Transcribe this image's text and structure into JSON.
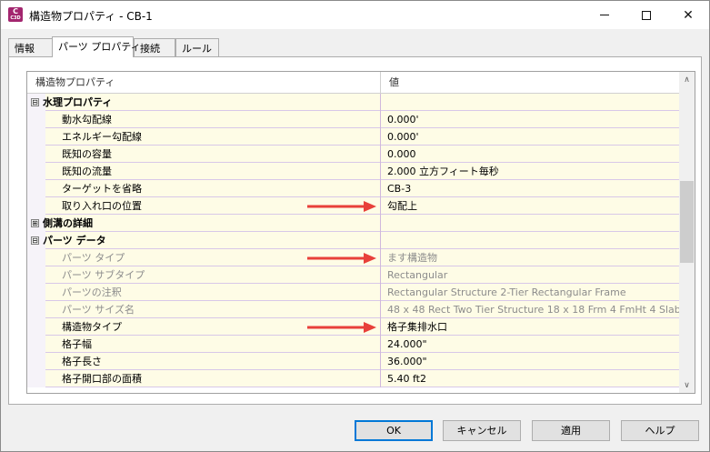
{
  "window": {
    "title": "構造物プロパティ - CB-1",
    "app_icon_letter": "C",
    "app_icon_sub": "C3D",
    "app_icon_name": "civil3d-app-icon",
    "minimize_glyph": "—",
    "maximize_glyph": "☐",
    "close_glyph": "✕"
  },
  "tabs": [
    {
      "label": "情報",
      "active": false
    },
    {
      "label": "パーツ プロパティ",
      "active": true
    },
    {
      "label": "接続",
      "active": false
    },
    {
      "label": "ルール",
      "active": false
    }
  ],
  "grid": {
    "header": {
      "property": "構造物プロパティ",
      "value": "値"
    },
    "rows": [
      {
        "type": "group",
        "expander": "⊟",
        "label": "水理プロパティ",
        "value": ""
      },
      {
        "type": "item",
        "label": "動水勾配線",
        "value": "0.000'"
      },
      {
        "type": "item",
        "label": "エネルギー勾配線",
        "value": "0.000'"
      },
      {
        "type": "item",
        "label": "既知の容量",
        "value": "0.000"
      },
      {
        "type": "item",
        "label": "既知の流量",
        "value": "2.000 立方フィート毎秒"
      },
      {
        "type": "item",
        "label": "ターゲットを省略",
        "value": "CB-3"
      },
      {
        "type": "item",
        "label": "取り入れ口の位置",
        "value": "勾配上",
        "arrow": true
      },
      {
        "type": "group",
        "expander": "⊞",
        "label": "側溝の詳細",
        "value": ""
      },
      {
        "type": "group",
        "expander": "⊟",
        "label": "パーツ データ",
        "value": ""
      },
      {
        "type": "disabled",
        "label": "パーツ タイプ",
        "value": "ます構造物",
        "arrow": true
      },
      {
        "type": "disabled",
        "label": "パーツ サブタイプ",
        "value": "Rectangular"
      },
      {
        "type": "disabled",
        "label": "パーツの注釈",
        "value": "Rectangular Structure 2-Tier Rectangular Frame"
      },
      {
        "type": "disabled",
        "label": "パーツ サイズ名",
        "value": "48 x 48 Rect Two Tier Structure 18 x 18 Frm 4 FmHt 4 Slab"
      },
      {
        "type": "item",
        "label": "構造物タイプ",
        "value": "格子集排水口",
        "arrow": true
      },
      {
        "type": "item",
        "label": "格子幅",
        "value": "24.000\""
      },
      {
        "type": "item",
        "label": "格子長さ",
        "value": "36.000\""
      },
      {
        "type": "item",
        "label": "格子開口部の面積",
        "value": "5.40 ft2"
      }
    ]
  },
  "scrollbar": {
    "up_glyph": "∧",
    "down_glyph": "∨"
  },
  "annotation_arrow_color": "#e8403a",
  "buttons": {
    "ok": "OK",
    "cancel": "キャンセル",
    "apply": "適用",
    "help": "ヘルプ"
  }
}
